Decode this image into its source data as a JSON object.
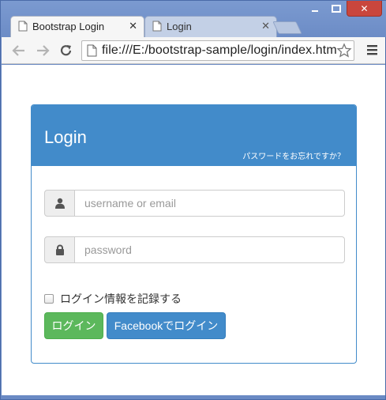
{
  "tabs": [
    {
      "label": "Bootstrap Login",
      "close": "✕",
      "active": true
    },
    {
      "label": "Login",
      "close": "✕",
      "active": false
    }
  ],
  "window_controls": {
    "close": "✕"
  },
  "address_bar": {
    "url": "file:///E:/bootstrap-sample/login/index.html"
  },
  "panel": {
    "title": "Login",
    "forgot_link": "パスワードをお忘れですか？"
  },
  "form": {
    "username_placeholder": "username or email",
    "password_placeholder": "password",
    "remember_label": "ログイン情報を記録する",
    "login_button": "ログイン",
    "facebook_button": "Facebookでログイン"
  },
  "colors": {
    "primary": "#428bca",
    "success": "#5cb85c",
    "window_close": "#c9463d"
  },
  "icons": {
    "username_addon": "user-icon",
    "password_addon": "lock-icon"
  }
}
